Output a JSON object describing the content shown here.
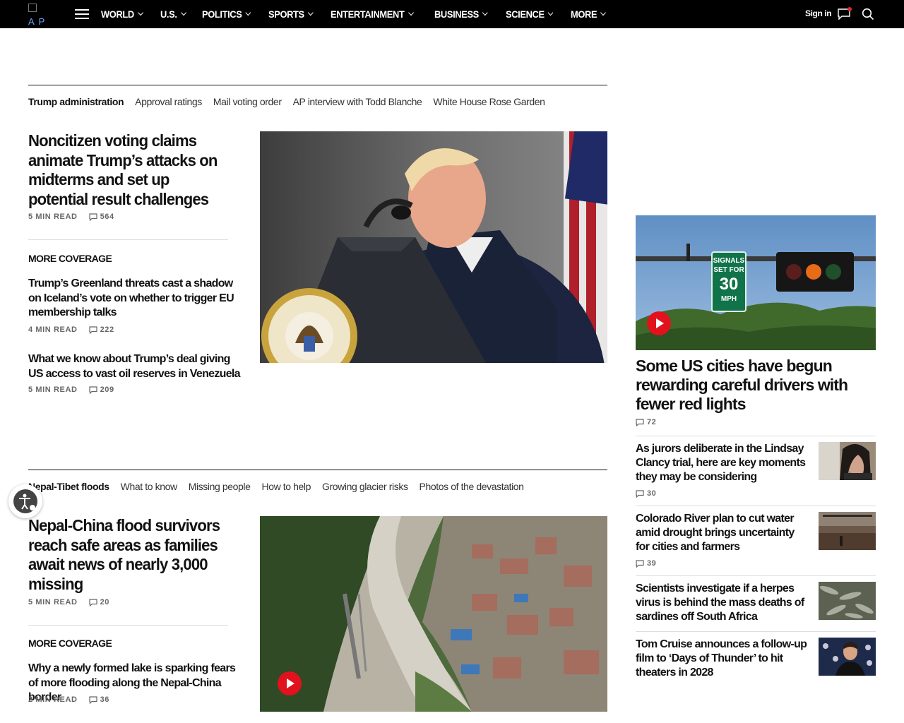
{
  "nav": {
    "logo_alt": "AP",
    "items": [
      "WORLD",
      "U.S.",
      "POLITICS",
      "SPORTS",
      "ENTERTAINMENT",
      "BUSINESS",
      "SCIENCE",
      "MORE"
    ],
    "signin": "Sign in"
  },
  "section1": {
    "tags": [
      "Trump administration",
      "Approval ratings",
      "Mail voting order",
      "AP interview with Todd Blanche",
      "White House Rose Garden"
    ],
    "lead": {
      "headline": "Noncitizen voting claims animate Trump’s attacks on midterms and set up potential result challenges",
      "read": "5 MIN READ",
      "comments": "564"
    },
    "more_coverage": "MORE COVERAGE",
    "related": [
      {
        "headline": "Trump’s Greenland threats cast a shadow on Iceland’s vote on whether to trigger EU membership talks",
        "read": "4 MIN READ",
        "comments": "222"
      },
      {
        "headline": "What we know about Trump’s deal giving US access to vast oil reserves in Venezuela",
        "read": "5 MIN READ",
        "comments": "209"
      }
    ]
  },
  "section2": {
    "tags": [
      "Nepal-Tibet floods",
      "What to know",
      "Missing people",
      "How to help",
      "Growing glacier risks",
      "Photos of the devastation"
    ],
    "lead": {
      "headline": "Nepal-China flood survivors reach safe areas as families await news of nearly 3,000 missing",
      "read": "5 MIN READ",
      "comments": "20"
    },
    "more_coverage": "MORE COVERAGE",
    "related": [
      {
        "headline": "Why a newly formed lake is sparking fears of more flooding along the Nepal-China border",
        "read": "2 MIN READ",
        "comments": "36"
      }
    ]
  },
  "right": {
    "lead": {
      "headline": "Some US cities have begun rewarding careful drivers with fewer red lights",
      "comments": "72"
    },
    "sign": {
      "line1": "SIGNALS",
      "line2": "SET FOR",
      "line3": "30",
      "line4": "MPH"
    },
    "items": [
      {
        "headline": "As jurors deliberate in the Lindsay Clancy trial, here are key moments they may be considering",
        "comments": "30"
      },
      {
        "headline": "Colorado River plan to cut water amid drought brings uncertainty for cities and farmers",
        "comments": "39"
      },
      {
        "headline": "Scientists investigate if a herpes virus is behind the mass deaths of sardines off South Africa",
        "comments": ""
      },
      {
        "headline": "Tom Cruise announces a follow-up film to ‘Days of Thunder’ to hit theaters in 2028",
        "comments": ""
      }
    ]
  },
  "colors": {
    "accent_red": "#e1121d",
    "nav_bg": "#000000"
  }
}
